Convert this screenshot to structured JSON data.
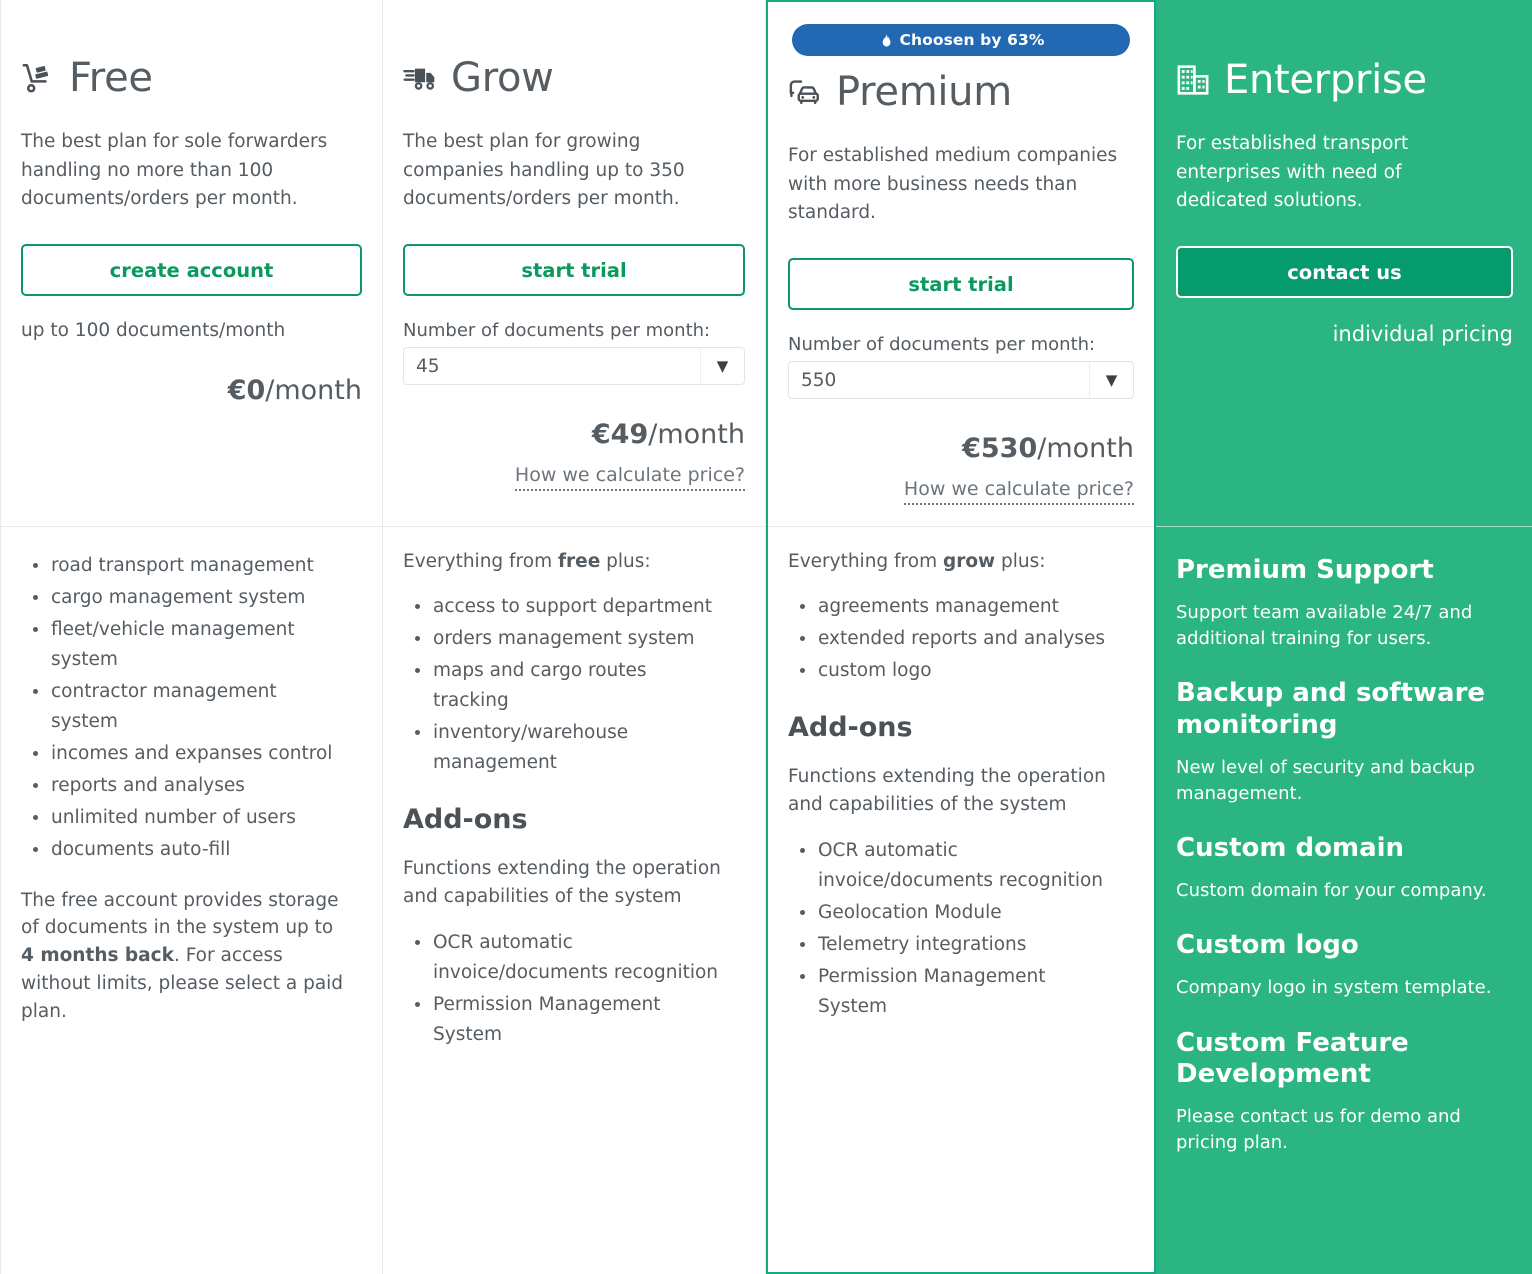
{
  "colors": {
    "brand_green": "#2bb583",
    "button_green": "#0b9960",
    "contact_button_green": "#069b6c",
    "highlight_border": "#17a87f",
    "badge_blue": "#2268b3",
    "text": "#555c62"
  },
  "plans": [
    {
      "id": "free",
      "icon": "hand-truck-icon",
      "name": "Free",
      "description": "The best plan for sole forwarders handling no more than 100 documents/orders per month.",
      "cta_label": "create account",
      "limit_note": "up to 100 documents/month",
      "price_amount": "€0",
      "price_period": "/month",
      "features": [
        "road transport management",
        "cargo management system",
        "fleet/vehicle management system",
        "contractor management system",
        "incomes and expanses control",
        "reports and analyses",
        "unlimited number of users",
        "documents auto-fill"
      ],
      "footnote_part1": "The free account provides storage of documents in the system up to ",
      "footnote_bold": "4 months back",
      "footnote_part2": ". For access without limits, please select a paid plan."
    },
    {
      "id": "grow",
      "icon": "delivery-truck-icon",
      "name": "Grow",
      "description": "The best plan for growing companies handling up to 350 documents/orders per month.",
      "cta_label": "start trial",
      "select_label": "Number of documents per month:",
      "select_value": "45",
      "price_amount": "€49",
      "price_period": "/month",
      "calc_link": "How we calculate price?",
      "intro_prefix": "Everything from ",
      "intro_bold": "free",
      "intro_suffix": " plus:",
      "features": [
        "access to support department",
        "orders management system",
        "maps and cargo routes tracking",
        "inventory/warehouse management"
      ],
      "addons_heading": "Add-ons",
      "addons_subtitle": "Functions extending the operation and capabilities of the system",
      "addons": [
        "OCR automatic invoice/documents recognition",
        "Permission Management System"
      ]
    },
    {
      "id": "premium",
      "icon": "vehicles-fleet-icon",
      "badge_text": "Choosen by 63%",
      "badge_icon": "flame-icon",
      "name": "Premium",
      "description": "For established medium companies with more business needs than standard.",
      "cta_label": "start trial",
      "select_label": "Number of documents per month:",
      "select_value": "550",
      "price_amount": "€530",
      "price_period": "/month",
      "calc_link": "How we calculate price?",
      "intro_prefix": "Everything from ",
      "intro_bold": "grow",
      "intro_suffix": " plus:",
      "features": [
        "agreements management",
        "extended reports and analyses",
        "custom logo"
      ],
      "addons_heading": "Add-ons",
      "addons_subtitle": "Functions extending the operation and capabilities of the system",
      "addons": [
        "OCR automatic invoice/documents recognition",
        "Geolocation Module",
        "Telemetry integrations",
        "Permission Management System"
      ]
    },
    {
      "id": "enterprise",
      "icon": "building-icon",
      "name": "Enterprise",
      "description": "For established transport enterprises with need of dedicated solutions.",
      "cta_label": "contact us",
      "pricing_note": "individual pricing",
      "feature_blocks": [
        {
          "heading": "Premium Support",
          "text": "Support team available 24/7 and additional training for users."
        },
        {
          "heading": "Backup and software monitoring",
          "text": "New level of security and backup management."
        },
        {
          "heading": "Custom domain",
          "text": "Custom domain for your company."
        },
        {
          "heading": "Custom logo",
          "text": "Company logo in system template."
        },
        {
          "heading": "Custom Feature Development",
          "text": "Please contact us for demo and pricing plan."
        }
      ]
    }
  ],
  "select_arrow_glyph": "▼"
}
